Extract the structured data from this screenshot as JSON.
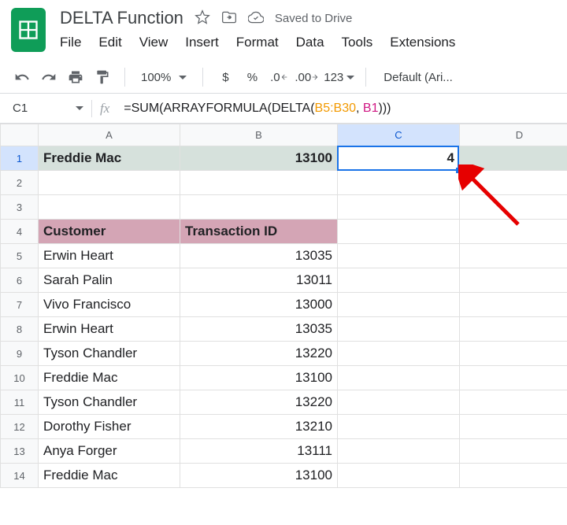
{
  "header": {
    "title": "DELTA Function",
    "saved": "Saved to Drive"
  },
  "menu": {
    "file": "File",
    "edit": "Edit",
    "view": "View",
    "insert": "Insert",
    "format": "Format",
    "data": "Data",
    "tools": "Tools",
    "extensions": "Extensions"
  },
  "toolbar": {
    "zoom": "100%",
    "currency": "$",
    "percent": "%",
    "dec_dec": ".0",
    "dec_inc": ".00",
    "numfmt": "123",
    "font": "Default (Ari..."
  },
  "formula": {
    "cell": "C1",
    "prefix": "=SUM(ARRAYFORMULA(DELTA(",
    "ref1": "B5:B30",
    "comma": ", ",
    "ref2": "B1",
    "suffix": ")))"
  },
  "columns": {
    "A": "A",
    "B": "B",
    "C": "C",
    "D": "D"
  },
  "rows": {
    "1": {
      "n": "1",
      "A": "Freddie Mac",
      "B": "13100",
      "C": "4"
    },
    "2": {
      "n": "2"
    },
    "3": {
      "n": "3"
    },
    "4": {
      "n": "4",
      "A": "Customer",
      "B": "Transaction ID"
    },
    "5": {
      "n": "5",
      "A": "Erwin Heart",
      "B": "13035"
    },
    "6": {
      "n": "6",
      "A": "Sarah Palin",
      "B": "13011"
    },
    "7": {
      "n": "7",
      "A": "Vivo Francisco",
      "B": "13000"
    },
    "8": {
      "n": "8",
      "A": "Erwin Heart",
      "B": "13035"
    },
    "9": {
      "n": "9",
      "A": "Tyson Chandler",
      "B": "13220"
    },
    "10": {
      "n": "10",
      "A": "Freddie Mac",
      "B": "13100"
    },
    "11": {
      "n": "11",
      "A": "Tyson Chandler",
      "B": "13220"
    },
    "12": {
      "n": "12",
      "A": "Dorothy Fisher",
      "B": "13210"
    },
    "13": {
      "n": "13",
      "A": "Anya Forger",
      "B": "13111"
    },
    "14": {
      "n": "14",
      "A": "Freddie Mac",
      "B": "13100"
    }
  }
}
